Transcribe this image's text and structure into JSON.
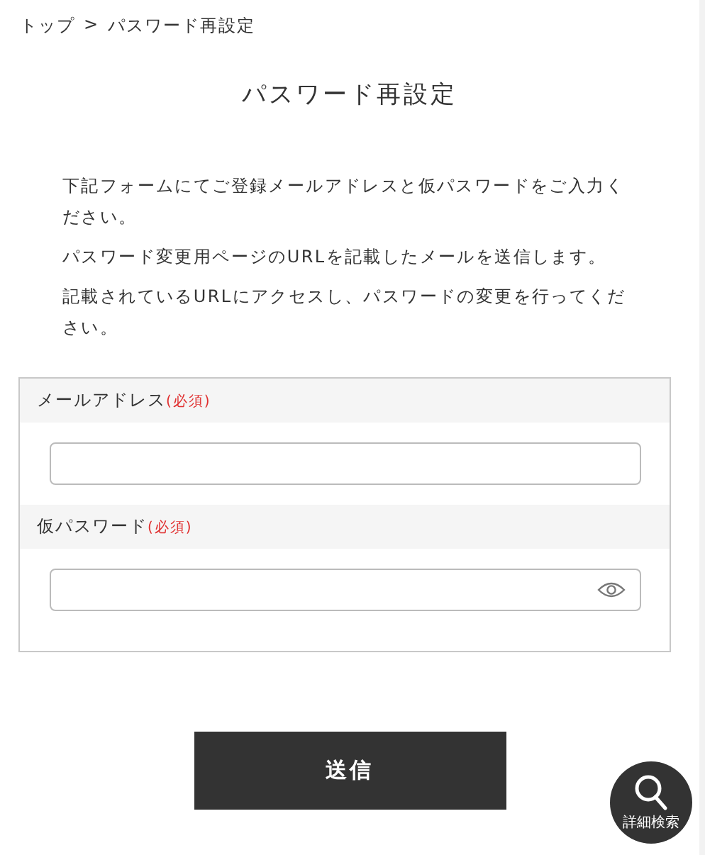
{
  "breadcrumb": {
    "items": [
      "トップ",
      "パスワード再設定"
    ],
    "separator": ">"
  },
  "title": "パスワード再設定",
  "paragraphs": [
    "下記フォームにてご登録メールアドレスと仮パスワードをご入力ください。",
    "パスワード変更用ページのURLを記載したメールを送信します。",
    "記載されているURLにアクセスし、パスワードの変更を行ってください。"
  ],
  "fields": [
    {
      "label": "メールアドレス",
      "required": "(必須)",
      "kind": "email"
    },
    {
      "label": "仮パスワード",
      "required": "(必須)",
      "kind": "password"
    }
  ],
  "submit": "送信",
  "search_fab": {
    "label": "詳細検索"
  }
}
